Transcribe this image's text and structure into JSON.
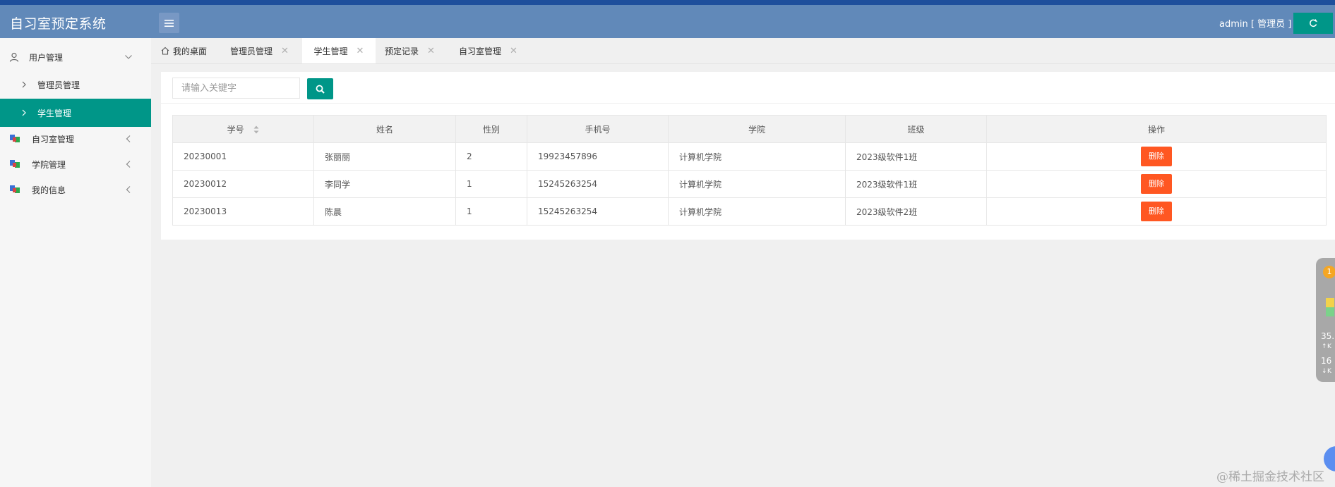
{
  "app": {
    "title": "自习室预定系统"
  },
  "header": {
    "user_label": "admin [ 管理员 ]"
  },
  "sidebar": {
    "items": [
      {
        "label": "用户管理"
      },
      {
        "label": "管理员管理"
      },
      {
        "label": "学生管理"
      },
      {
        "label": "自习室管理"
      },
      {
        "label": "学院管理"
      },
      {
        "label": "我的信息"
      }
    ]
  },
  "tabs": [
    {
      "label": "我的桌面"
    },
    {
      "label": "管理员管理"
    },
    {
      "label": "学生管理"
    },
    {
      "label": "预定记录"
    },
    {
      "label": "自习室管理"
    }
  ],
  "search": {
    "placeholder": "请输入关键字"
  },
  "table": {
    "columns": [
      "学号",
      "姓名",
      "性别",
      "手机号",
      "学院",
      "班级",
      "操作"
    ],
    "rows": [
      {
        "id": "20230001",
        "name": "张丽丽",
        "gender": "2",
        "phone": "19923457896",
        "college": "计算机学院",
        "class": "2023级软件1班",
        "action": "删除"
      },
      {
        "id": "20230012",
        "name": "李同学",
        "gender": "1",
        "phone": "15245263254",
        "college": "计算机学院",
        "class": "2023级软件1班",
        "action": "删除"
      },
      {
        "id": "20230013",
        "name": "陈晨",
        "gender": "1",
        "phone": "15245263254",
        "college": "计算机学院",
        "class": "2023级软件2班",
        "action": "删除"
      }
    ]
  },
  "widget": {
    "badge": "1",
    "up_value": "35.",
    "up_unit": "K",
    "down_value": "16",
    "down_unit": "K"
  },
  "watermark": "@稀土掘金技术社区",
  "colors": {
    "header": "#6189b9",
    "accent": "#009688",
    "danger": "#ff5722"
  }
}
